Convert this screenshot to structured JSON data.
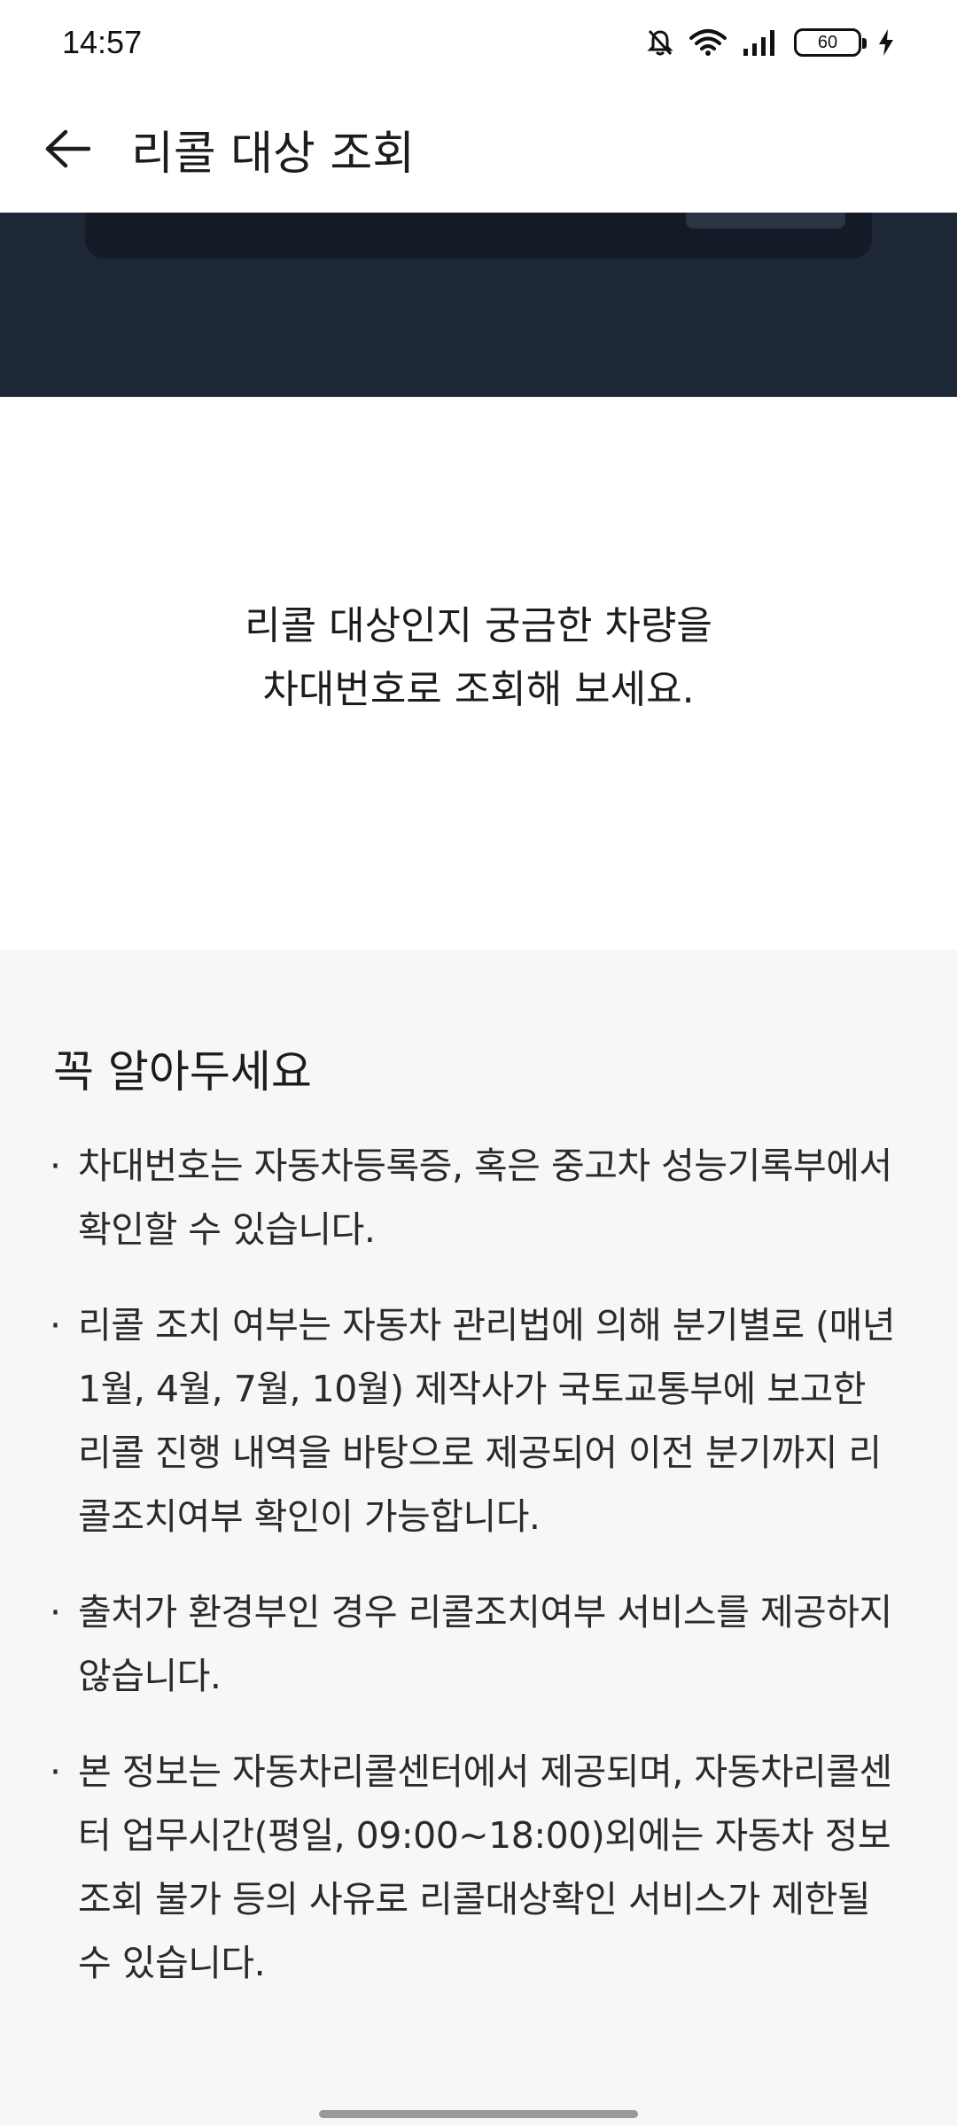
{
  "status_bar": {
    "time": "14:57",
    "battery_level": "60",
    "icons": [
      "mute-bell-icon",
      "wifi-icon",
      "signal-icon",
      "battery-icon",
      "charging-icon"
    ]
  },
  "app_bar": {
    "title": "리콜 대상 조회",
    "back_icon": "arrow-left-icon"
  },
  "hero": {
    "line1": "리콜 대상인지 궁금한 차량을",
    "line2": "차대번호로 조회해 보세요."
  },
  "notice": {
    "title": "꼭 알아두세요",
    "items": [
      "차대번호는 자동차등록증, 혹은 중고차 성능기록부에서 확인할 수 있습니다.",
      "리콜 조치 여부는 자동차 관리법에 의해 분기별로 (매년 1월, 4월, 7월, 10월) 제작사가 국토교통부에 보고한 리콜 진행 내역을 바탕으로 제공되어 이전 분기까지 리콜조치여부 확인이 가능합니다.",
      "출처가 환경부인 경우 리콜조치여부 서비스를 제공하지 않습니다.",
      "본 정보는 자동차리콜센터에서 제공되며, 자동차리콜센터 업무시간(평일, 09:00~18:00)외에는 자동차 정보 조회 불가 등의 사유로 리콜대상확인 서비스가 제한될 수 있습니다."
    ]
  },
  "colors": {
    "banner": "#1d2735",
    "notice_bg": "#f7f7f8",
    "text": "#1c1c1e"
  }
}
